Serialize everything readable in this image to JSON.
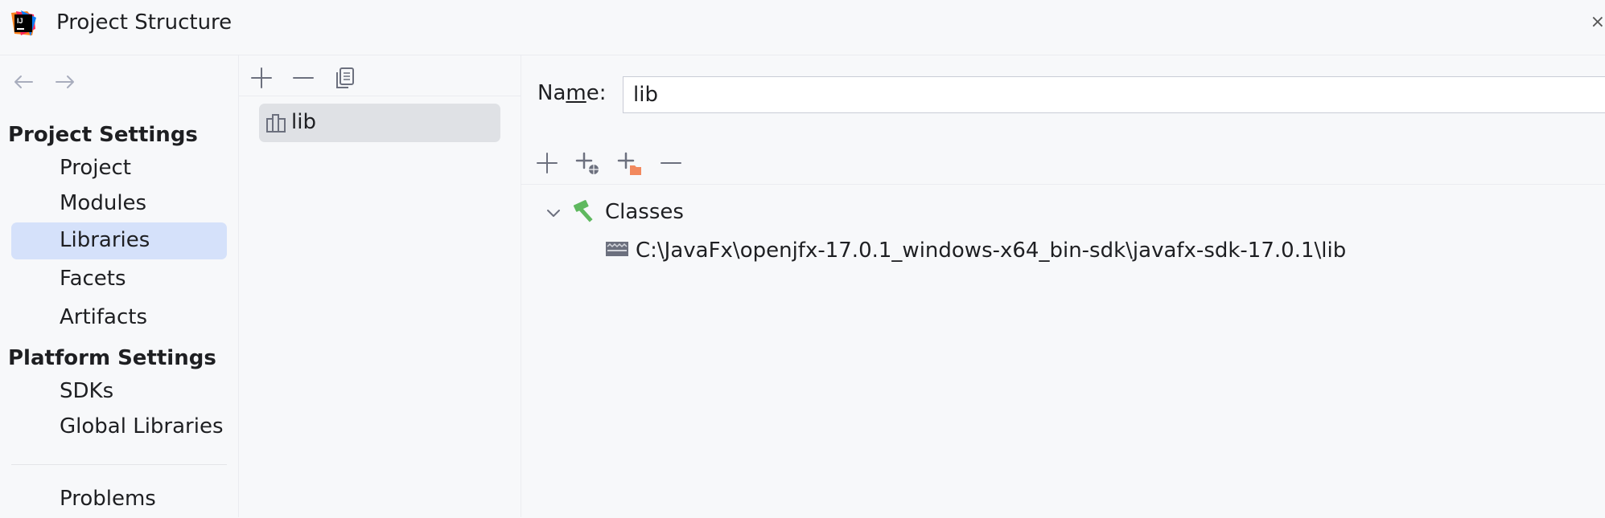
{
  "window": {
    "title": "Project Structure",
    "close_glyph": "⨯"
  },
  "sidebar": {
    "sections": [
      {
        "header": "Project Settings",
        "items": [
          "Project",
          "Modules",
          "Libraries",
          "Facets",
          "Artifacts"
        ]
      },
      {
        "header": "Platform Settings",
        "items": [
          "SDKs",
          "Global Libraries"
        ]
      }
    ],
    "bottom_item": "Problems",
    "selected": "Libraries"
  },
  "libraries_list": {
    "items": [
      {
        "label": "lib",
        "icon": "library-icon"
      }
    ]
  },
  "detail": {
    "name_label_pre": "Na",
    "name_label_mnemonic": "m",
    "name_label_post": "e:",
    "name_value": "lib",
    "tree": {
      "root_label": "Classes",
      "root_icon": "hammer-icon",
      "children": [
        "C:\\JavaFx\\openjfx-17.0.1_windows-x64_bin-sdk\\javafx-sdk-17.0.1\\lib"
      ]
    }
  },
  "icons": {
    "toolbar_middle": [
      "add-icon",
      "remove-icon",
      "copy-icon"
    ],
    "toolbar_right": [
      "add-icon",
      "add-url-icon",
      "add-folder-icon",
      "remove-icon"
    ]
  },
  "colors": {
    "selection": "#d5e1fa",
    "list_selection": "#dfe1e5",
    "hammer_green": "#5fb85f",
    "folder_orange": "#f2895e"
  }
}
